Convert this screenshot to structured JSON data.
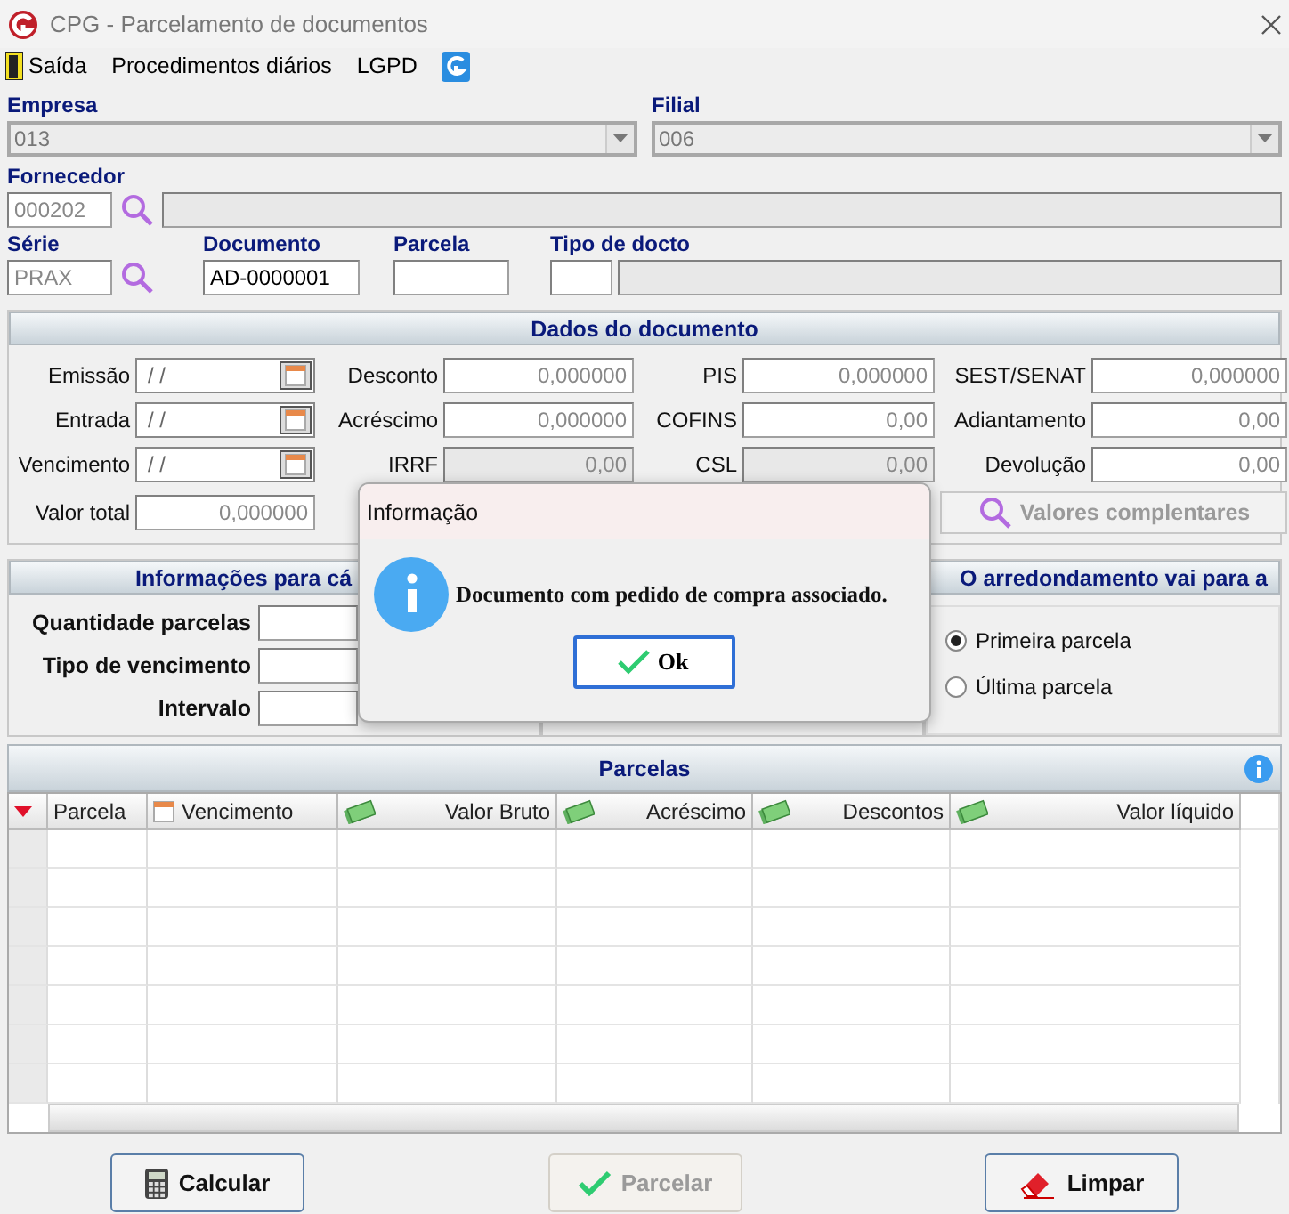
{
  "window": {
    "title": "CPG - Parcelamento de documentos"
  },
  "menu": [
    {
      "kind": "exit",
      "label": "Saída"
    },
    {
      "kind": "text",
      "label": "Procedimentos diários"
    },
    {
      "kind": "text",
      "label": "LGPD"
    },
    {
      "kind": "logo"
    }
  ],
  "empresa": {
    "label": "Empresa",
    "value": "013"
  },
  "filial": {
    "label": "Filial",
    "value": "006"
  },
  "fornecedor": {
    "label": "Fornecedor",
    "value": "000202"
  },
  "serie": {
    "label": "Série",
    "value": "PRAX"
  },
  "documento": {
    "label": "Documento",
    "value": "AD-0000001"
  },
  "parcela": {
    "label": "Parcela"
  },
  "tipo_docto": {
    "label": "Tipo de docto"
  },
  "dados": {
    "title": "Dados do documento",
    "columns": [
      [
        {
          "kind": "date",
          "label": "Emissão",
          "value": "/ /"
        },
        {
          "kind": "date",
          "label": "Entrada",
          "value": "/ /"
        },
        {
          "kind": "date",
          "label": "Vencimento",
          "value": "/ /"
        },
        {
          "kind": "number",
          "label": "Valor total",
          "value": "0,000000",
          "disabled": false
        }
      ],
      [
        {
          "kind": "number",
          "label": "Desconto",
          "value": "0,000000",
          "disabled": false
        },
        {
          "kind": "number",
          "label": "Acréscimo",
          "value": "0,000000",
          "disabled": false
        },
        {
          "kind": "number",
          "label": "IRRF",
          "value": "0,00",
          "disabled": true
        }
      ],
      [
        {
          "kind": "number",
          "label": "PIS",
          "value": "0,000000",
          "disabled": false
        },
        {
          "kind": "number",
          "label": "COFINS",
          "value": "0,00",
          "disabled": false
        },
        {
          "kind": "number",
          "label": "CSL",
          "value": "0,00",
          "disabled": true
        }
      ],
      [
        {
          "kind": "number",
          "label": "SEST/SENAT",
          "value": "0,000000",
          "disabled": false
        },
        {
          "kind": "number",
          "label": "Adiantamento",
          "value": "0,00",
          "disabled": false
        },
        {
          "kind": "number",
          "label": "Devolução",
          "value": "0,00",
          "disabled": false
        },
        {
          "kind": "button",
          "label": "Valores complentares",
          "disabled": true
        }
      ]
    ]
  },
  "calculo": {
    "title": "Informações para cá",
    "fields": [
      "Quantidade parcelas",
      "Tipo de vencimento",
      "Intervalo"
    ]
  },
  "arredondamento": {
    "title": "O arredondamento vai para a",
    "options": [
      {
        "label": "Primeira parcela",
        "selected": true
      },
      {
        "label": "Última parcela",
        "selected": false
      }
    ]
  },
  "parcelas": {
    "title": "Parcelas",
    "columns": [
      {
        "label": "Parcela"
      },
      {
        "label": "Vencimento"
      },
      {
        "label": "Valor Bruto"
      },
      {
        "label": "Acréscimo"
      },
      {
        "label": "Descontos"
      },
      {
        "label": "Valor líquido"
      }
    ]
  },
  "buttons": [
    {
      "label": "Calcular",
      "disabled": false
    },
    {
      "label": "Parcelar",
      "disabled": true
    },
    {
      "label": "Limpar",
      "disabled": false
    }
  ],
  "dialog": {
    "title": "Informação",
    "message": "Documento com pedido de compra associado.",
    "button": "Ok"
  }
}
